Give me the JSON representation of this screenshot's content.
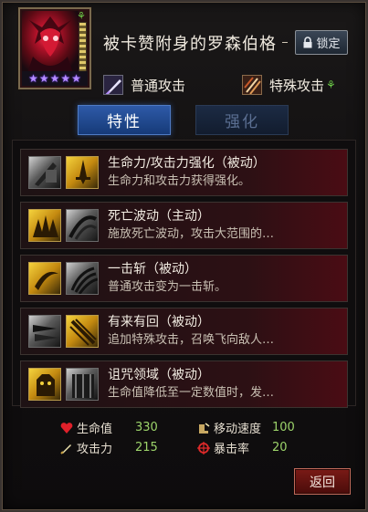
{
  "character": {
    "name": "被卡赞附身的罗森伯格",
    "stars": 5,
    "lock_label": "锁定",
    "normal_attack_label": "普通攻击",
    "special_attack_label": "特殊攻击"
  },
  "tabs": [
    {
      "label": "特性",
      "active": true
    },
    {
      "label": "强化",
      "active": false
    }
  ],
  "skills": [
    {
      "title": "生命力/攻击力强化（被动）",
      "desc": "生命力和攻击力获得强化。",
      "icons": [
        "sword-shield-icon",
        "gold-sword-icon"
      ]
    },
    {
      "title": "死亡波动（主动）",
      "desc": "施放死亡波动，攻击大范围的…",
      "icons": [
        "gold-shockwave-icon",
        "slash-wave-icon"
      ]
    },
    {
      "title": "一击斩（被动）",
      "desc": "普通攻击变为一击斩。",
      "icons": [
        "gold-crescent-icon",
        "claw-slash-icon"
      ]
    },
    {
      "title": "有来有回（被动）",
      "desc": "追加特殊攻击，召唤飞向敌人…",
      "icons": [
        "triple-blade-icon",
        "gold-cross-blades-icon"
      ]
    },
    {
      "title": "诅咒领域（被动）",
      "desc": "生命值降低至一定数值时，发…",
      "icons": [
        "gold-demon-icon",
        "cursed-gate-icon"
      ]
    }
  ],
  "stats": {
    "hp_label": "生命值",
    "hp_value": "330",
    "atk_label": "攻击力",
    "atk_value": "215",
    "speed_label": "移动速度",
    "speed_value": "100",
    "crit_label": "暴击率",
    "crit_value": "20"
  },
  "return_label": "返回",
  "colors": {
    "accent_blue": "#2e5aa8",
    "stat_green": "#9cd36a",
    "return_red": "#7a1a16"
  }
}
